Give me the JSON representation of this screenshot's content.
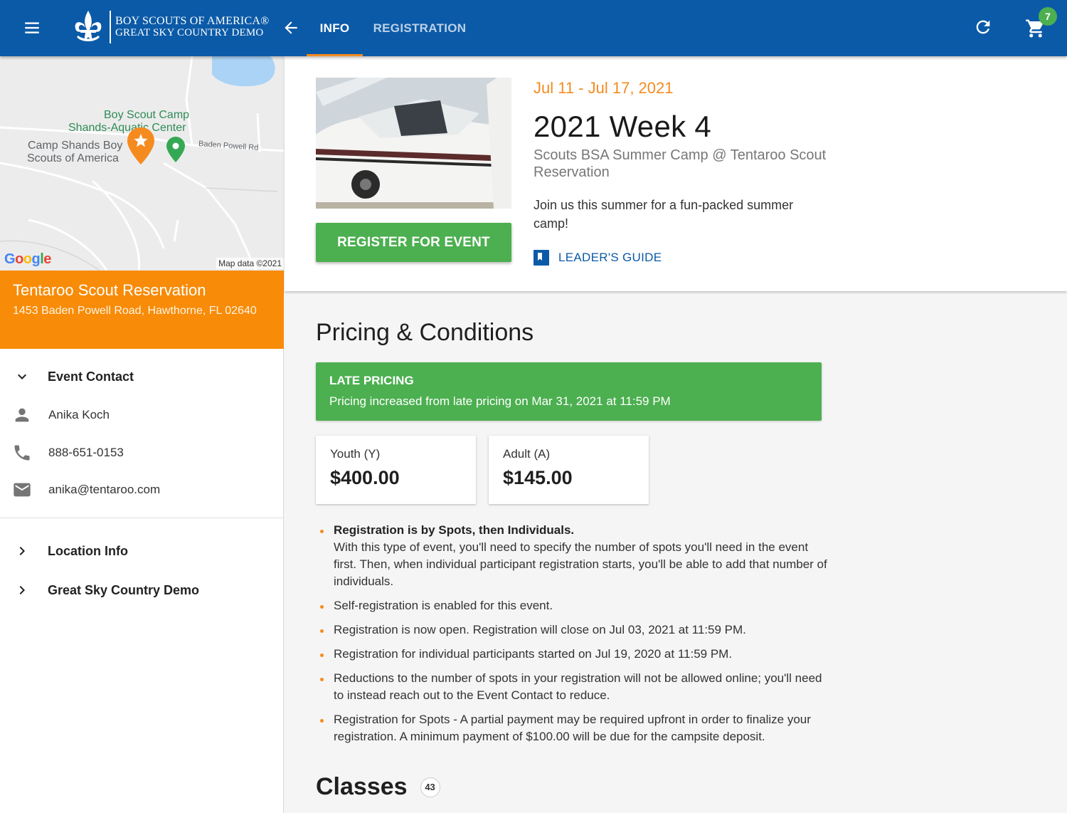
{
  "header": {
    "logo_line1": "BOY SCOUTS OF AMERICA®",
    "logo_line2": "GREAT SKY COUNTRY DEMO",
    "tabs": [
      {
        "label": "INFO",
        "active": true
      },
      {
        "label": "REGISTRATION",
        "active": false
      }
    ],
    "cart_count": "7",
    "bar_color": "#0b5aa7"
  },
  "map": {
    "labels": {
      "camp_line1": "Boy Scout Camp",
      "camp_line2": "Shands-Aquatic Center",
      "place_line1": "Camp Shands Boy",
      "place_line2": "Scouts of America",
      "road": "Baden Powell Rd"
    },
    "google": "Google",
    "credit": "Map data ©2021"
  },
  "venue": {
    "name": "Tentaroo Scout Reservation",
    "address": "1453 Baden Powell Road, Hawthorne, FL 02640",
    "color": "#f88b07"
  },
  "sidebar": {
    "event_contact": {
      "title": "Event Contact",
      "name": "Anika Koch",
      "phone": "888-651-0153",
      "email": "anika@tentaroo.com"
    },
    "sections": [
      {
        "title": "Location Info"
      },
      {
        "title": "Great Sky Country Demo"
      }
    ]
  },
  "event": {
    "dates": "Jul 11 - Jul 17, 2021",
    "title": "2021 Week 4",
    "subtitle": "Scouts BSA Summer Camp @ Tentaroo Scout Reservation",
    "description": "Join us this summer for a fun-packed summer camp!",
    "register_label": "REGISTER FOR EVENT",
    "guide_label": "LEADER'S GUIDE",
    "accent": "#f58b1f"
  },
  "pricing": {
    "heading": "Pricing & Conditions",
    "late_title": "LATE PRICING",
    "late_text": "Pricing increased from late pricing on Mar 31, 2021 at 11:59 PM",
    "prices": [
      {
        "label": "Youth (Y)",
        "amount": "$400.00"
      },
      {
        "label": "Adult (A)",
        "amount": "$145.00"
      }
    ],
    "notes": [
      {
        "bold": "Registration is by Spots, then Individuals.",
        "text": "With this type of event, you'll need to specify the number of spots you'll need in the event first. Then, when individual participant registration starts, you'll be able to add that number of individuals."
      },
      {
        "text": "Self-registration is enabled for this event."
      },
      {
        "text": "Registration is now open. Registration will close on Jul 03, 2021 at 11:59 PM."
      },
      {
        "text": "Registration for individual participants started on Jul 19, 2020 at 11:59 PM."
      },
      {
        "text": "Reductions to the number of spots in your registration will not be allowed online; you'll need to instead reach out to the Event Contact to reduce."
      },
      {
        "text": "Registration for Spots - A partial payment may be required upfront in order to finalize your registration. A minimum payment of $100.00 will be due for the campsite deposit."
      }
    ],
    "green": "#4caf50"
  },
  "classes": {
    "heading": "Classes",
    "count": "43"
  }
}
